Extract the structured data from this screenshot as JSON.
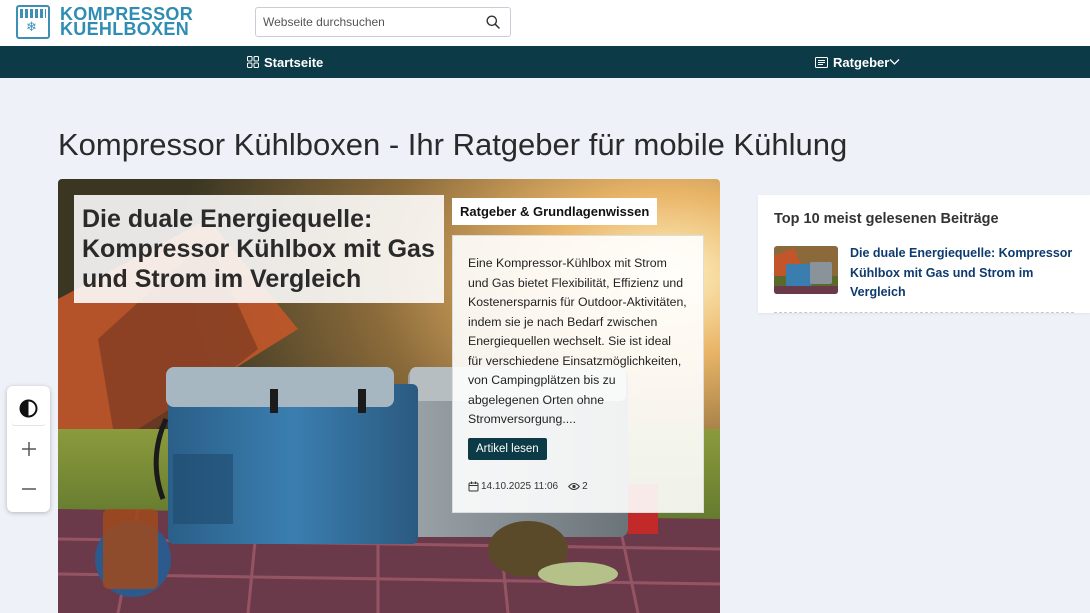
{
  "header": {
    "logo_line1": "KOMPRESSOR",
    "logo_line2": "KUEHLBOXEN",
    "search_placeholder": "Webseite durchsuchen",
    "search_icon": "search-icon"
  },
  "nav": {
    "home_label": "Startseite",
    "home_icon": "grid-icon",
    "ratgeber_label": "Ratgeber",
    "ratgeber_icon": "article-icon"
  },
  "page": {
    "title": "Kompressor Kühlboxen - Ihr Ratgeber für mobile Kühlung"
  },
  "hero": {
    "title": "Die duale Energiequelle: Kompressor Kühlbox mit Gas und Strom im Vergleich",
    "category": "Ratgeber & Grundlagenwissen",
    "excerpt": "Eine Kompressor-Kühlbox mit Strom und Gas bietet Flexibilität, Effizienz und Kostenersparnis für Outdoor-Aktivitäten, indem sie je nach Bedarf zwischen Energiequellen wechselt. Sie ist ideal für verschiedene Einsatzmöglichkeiten, von Campingplätzen bis zu abgelegenen Orten ohne Stromversorgung....",
    "read_button": "Artikel lesen",
    "date": "14.10.2025 11:06",
    "views": "2"
  },
  "a11y": {
    "contrast_icon": "contrast-icon",
    "zoom_in_icon": "plus-icon",
    "zoom_out_icon": "minus-icon"
  },
  "sidebar": {
    "title": "Top 10 meist gelesenen Beiträge",
    "items": [
      {
        "title": "Die duale Energiequelle: Kompressor Kühlbox mit Gas und Strom im Vergleich"
      }
    ]
  },
  "colors": {
    "brand": "#2f8db3",
    "navbar": "#0c3b47",
    "link": "#0e3a6e",
    "background": "#eef2f8"
  }
}
